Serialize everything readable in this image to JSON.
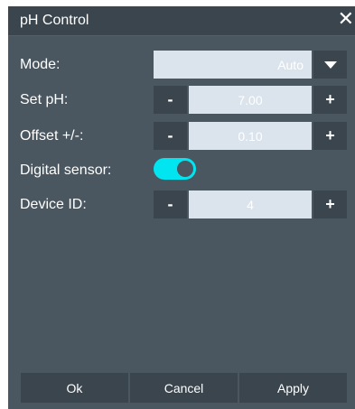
{
  "window": {
    "title": "pH Control",
    "close_glyph": "✕"
  },
  "rows": {
    "mode": {
      "label": "Mode:",
      "value": "Auto"
    },
    "set_ph": {
      "label": "Set pH:",
      "minus": "-",
      "value": "7.00",
      "plus": "+"
    },
    "offset": {
      "label": "Offset +/-:",
      "minus": "-",
      "value": "0.10",
      "plus": "+"
    },
    "digital_sensor": {
      "label": "Digital sensor:",
      "state": "on"
    },
    "device_id": {
      "label": "Device ID:",
      "minus": "-",
      "value": "4",
      "plus": "+"
    }
  },
  "footer": {
    "ok": "Ok",
    "cancel": "Cancel",
    "apply": "Apply"
  },
  "colors": {
    "accent": "#00e5f0",
    "panel": "#4a5660",
    "header": "#3a454e",
    "field": "#dbe4ec"
  }
}
